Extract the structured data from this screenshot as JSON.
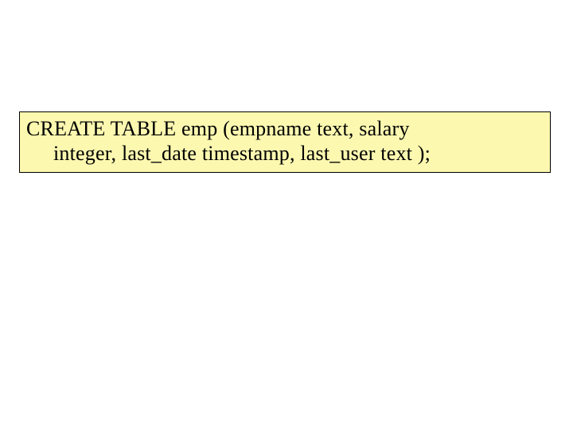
{
  "code": {
    "line1": "CREATE TABLE emp (empname text, salary",
    "line2": "integer, last_date timestamp, last_user text );"
  }
}
